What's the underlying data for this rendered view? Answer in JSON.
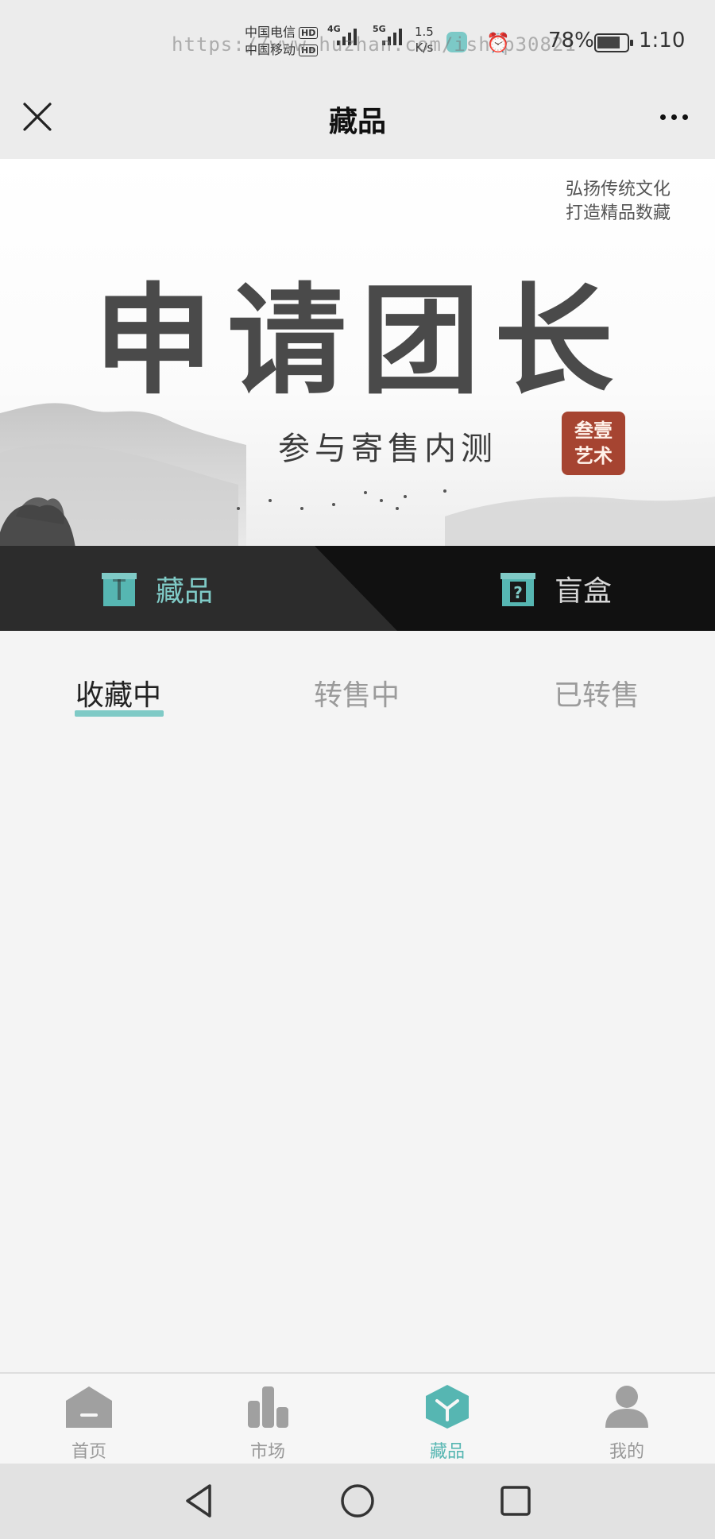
{
  "status_bar": {
    "carrier_1": "中国电信",
    "carrier_2": "中国移动",
    "hd_badge": "HD",
    "network_1": "4G",
    "network_2": "5G",
    "net_speed_value": "1.5",
    "net_speed_unit": "K/s",
    "watermark": "https://www.huzhan.com/ishop30821",
    "battery": "78%",
    "battery_level": 0.78,
    "time": "1:10"
  },
  "title_bar": {
    "title": "藏品"
  },
  "banner": {
    "slogan_line_1": "弘扬传统文化",
    "slogan_line_2": "打造精品数藏",
    "headline": "申请团长",
    "subheadline": "参与寄售内测",
    "seal_line_1": "叁壹",
    "seal_line_2": "艺术"
  },
  "category_tabs": {
    "collection": "藏品",
    "blind_box": "盲盒",
    "active": "collection"
  },
  "sub_tabs": {
    "collecting": "收藏中",
    "reselling": "转售中",
    "resold": "已转售",
    "active": "collecting"
  },
  "bottom_nav": {
    "home": "首页",
    "market": "市场",
    "collection": "藏品",
    "mine": "我的",
    "active": "collection"
  },
  "colors": {
    "accent": "#7fcac6",
    "accent_dark": "#56b6b2",
    "seal": "#a64431",
    "category_bar": "#111111",
    "category_active_bg": "#2c2c2c",
    "inactive_text": "#9b9b9b"
  }
}
